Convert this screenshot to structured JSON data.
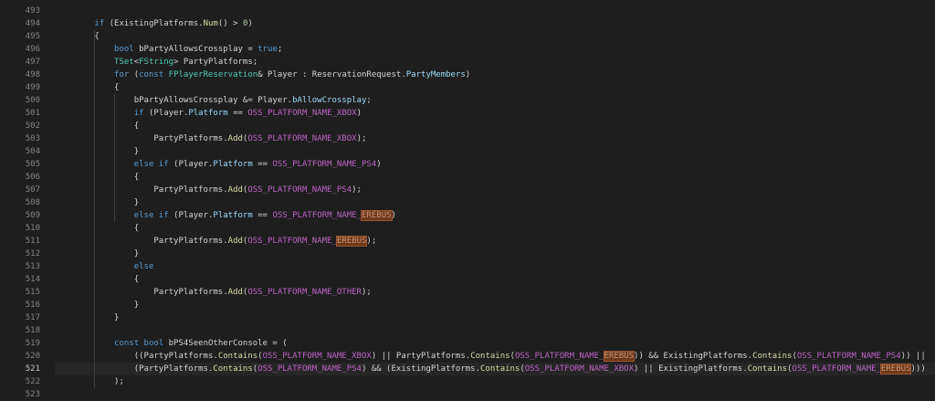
{
  "editor": {
    "lines": [
      {
        "n": "493",
        "tokens": []
      },
      {
        "n": "494",
        "tokens": [
          [
            "",
            "        "
          ],
          [
            "kw",
            "if"
          ],
          [
            "",
            " (ExistingPlatforms."
          ],
          [
            "fn",
            "Num"
          ],
          [
            "",
            "() > "
          ],
          [
            "num",
            "0"
          ],
          [
            "",
            ")"
          ]
        ]
      },
      {
        "n": "495",
        "tokens": [
          [
            "",
            "        {"
          ]
        ]
      },
      {
        "n": "496",
        "tokens": [
          [
            "",
            "            "
          ],
          [
            "kw",
            "bool"
          ],
          [
            "",
            " bPartyAllowsCrossplay = "
          ],
          [
            "kw",
            "true"
          ],
          [
            "",
            ";"
          ]
        ]
      },
      {
        "n": "497",
        "tokens": [
          [
            "",
            "            "
          ],
          [
            "ty",
            "TSet"
          ],
          [
            "",
            "<"
          ],
          [
            "ty",
            "FString"
          ],
          [
            "",
            "> PartyPlatforms;"
          ]
        ]
      },
      {
        "n": "498",
        "tokens": [
          [
            "",
            "            "
          ],
          [
            "kw",
            "for"
          ],
          [
            "",
            " ("
          ],
          [
            "kw",
            "const"
          ],
          [
            "",
            " "
          ],
          [
            "ty",
            "FPlayerReservation"
          ],
          [
            "",
            "& Player : ReservationRequest."
          ],
          [
            "var",
            "PartyMembers"
          ],
          [
            "",
            ")"
          ]
        ]
      },
      {
        "n": "499",
        "tokens": [
          [
            "",
            "            {"
          ]
        ]
      },
      {
        "n": "500",
        "tokens": [
          [
            "",
            "                bPartyAllowsCrossplay &= Player."
          ],
          [
            "var",
            "bAllowCrossplay"
          ],
          [
            "",
            ";"
          ]
        ]
      },
      {
        "n": "501",
        "tokens": [
          [
            "",
            "                "
          ],
          [
            "kw",
            "if"
          ],
          [
            "",
            " (Player."
          ],
          [
            "var",
            "Platform"
          ],
          [
            "",
            " == "
          ],
          [
            "mac",
            "OSS_PLATFORM_NAME_XBOX"
          ],
          [
            "",
            ")"
          ]
        ]
      },
      {
        "n": "502",
        "tokens": [
          [
            "",
            "                {"
          ]
        ]
      },
      {
        "n": "503",
        "tokens": [
          [
            "",
            "                    PartyPlatforms."
          ],
          [
            "fn",
            "Add"
          ],
          [
            "",
            "("
          ],
          [
            "mac",
            "OSS_PLATFORM_NAME_XBOX"
          ],
          [
            "",
            ");"
          ]
        ]
      },
      {
        "n": "504",
        "tokens": [
          [
            "",
            "                }"
          ]
        ]
      },
      {
        "n": "505",
        "tokens": [
          [
            "",
            "                "
          ],
          [
            "kw",
            "else if"
          ],
          [
            "",
            " (Player."
          ],
          [
            "var",
            "Platform"
          ],
          [
            "",
            " == "
          ],
          [
            "mac",
            "OSS_PLATFORM_NAME_PS4"
          ],
          [
            "",
            ")"
          ]
        ]
      },
      {
        "n": "506",
        "tokens": [
          [
            "",
            "                {"
          ]
        ]
      },
      {
        "n": "507",
        "tokens": [
          [
            "",
            "                    PartyPlatforms."
          ],
          [
            "fn",
            "Add"
          ],
          [
            "",
            "("
          ],
          [
            "mac",
            "OSS_PLATFORM_NAME_PS4"
          ],
          [
            "",
            ");"
          ]
        ]
      },
      {
        "n": "508",
        "tokens": [
          [
            "",
            "                }"
          ]
        ]
      },
      {
        "n": "509",
        "tokens": [
          [
            "",
            "                "
          ],
          [
            "kw",
            "else if"
          ],
          [
            "",
            " (Player."
          ],
          [
            "var",
            "Platform"
          ],
          [
            "",
            " == "
          ],
          [
            "mac",
            "OSS_PLATFORM_NAME_"
          ],
          [
            "hl",
            "EREBUS"
          ],
          [
            "",
            ")"
          ]
        ]
      },
      {
        "n": "510",
        "tokens": [
          [
            "",
            "                {"
          ]
        ]
      },
      {
        "n": "511",
        "tokens": [
          [
            "",
            "                    PartyPlatforms."
          ],
          [
            "fn",
            "Add"
          ],
          [
            "",
            "("
          ],
          [
            "mac",
            "OSS_PLATFORM_NAME_"
          ],
          [
            "hl",
            "EREBUS"
          ],
          [
            "",
            ");"
          ]
        ]
      },
      {
        "n": "512",
        "tokens": [
          [
            "",
            "                }"
          ]
        ]
      },
      {
        "n": "513",
        "tokens": [
          [
            "",
            "                "
          ],
          [
            "kw",
            "else"
          ]
        ]
      },
      {
        "n": "514",
        "tokens": [
          [
            "",
            "                {"
          ]
        ]
      },
      {
        "n": "515",
        "tokens": [
          [
            "",
            "                    PartyPlatforms."
          ],
          [
            "fn",
            "Add"
          ],
          [
            "",
            "("
          ],
          [
            "mac",
            "OSS_PLATFORM_NAME_OTHER"
          ],
          [
            "",
            ");"
          ]
        ]
      },
      {
        "n": "516",
        "tokens": [
          [
            "",
            "                }"
          ]
        ]
      },
      {
        "n": "517",
        "tokens": [
          [
            "",
            "            }"
          ]
        ]
      },
      {
        "n": "518",
        "tokens": []
      },
      {
        "n": "519",
        "tokens": [
          [
            "",
            "            "
          ],
          [
            "kw",
            "const bool"
          ],
          [
            "",
            " bPS4SeenOtherConsole = ("
          ]
        ]
      },
      {
        "n": "520",
        "tokens": [
          [
            "",
            "                ((PartyPlatforms."
          ],
          [
            "fn",
            "Contains"
          ],
          [
            "",
            "("
          ],
          [
            "mac",
            "OSS_PLATFORM_NAME_XBOX"
          ],
          [
            "",
            ") || PartyPlatforms."
          ],
          [
            "fn",
            "Contains"
          ],
          [
            "",
            "("
          ],
          [
            "mac",
            "OSS_PLATFORM_NAME_"
          ],
          [
            "hl",
            "EREBUS"
          ],
          [
            "",
            ")) && ExistingPlatforms."
          ],
          [
            "fn",
            "Contains"
          ],
          [
            "",
            "("
          ],
          [
            "mac",
            "OSS_PLATFORM_NAME_PS4"
          ],
          [
            "",
            ")) ||"
          ]
        ]
      },
      {
        "n": "521",
        "active": true,
        "tokens": [
          [
            "",
            "                (PartyPlatforms."
          ],
          [
            "fn",
            "Contains"
          ],
          [
            "",
            "("
          ],
          [
            "mac",
            "OSS_PLATFORM_NAME_PS4"
          ],
          [
            "",
            ") && (ExistingPlatforms."
          ],
          [
            "fn",
            "Contains"
          ],
          [
            "",
            "("
          ],
          [
            "mac",
            "OSS_PLATFORM_NAME_XBOX"
          ],
          [
            "",
            ") || ExistingPlatforms."
          ],
          [
            "fn",
            "Contains"
          ],
          [
            "",
            "("
          ],
          [
            "mac",
            "OSS_PLATFORM_NAME_"
          ],
          [
            "hl",
            "EREBUS"
          ],
          [
            "",
            ")))"
          ]
        ]
      },
      {
        "n": "522",
        "tokens": [
          [
            "",
            "            );"
          ]
        ]
      },
      {
        "n": "523",
        "tokens": []
      }
    ]
  },
  "colors": {
    "background": "#1e1e1e",
    "keyword": "#569cd6",
    "type": "#4ec9b0",
    "function": "#dcdcaa",
    "member": "#9cdcfe",
    "macro": "#bd63c5",
    "search_highlight": "#6b3a1a"
  }
}
